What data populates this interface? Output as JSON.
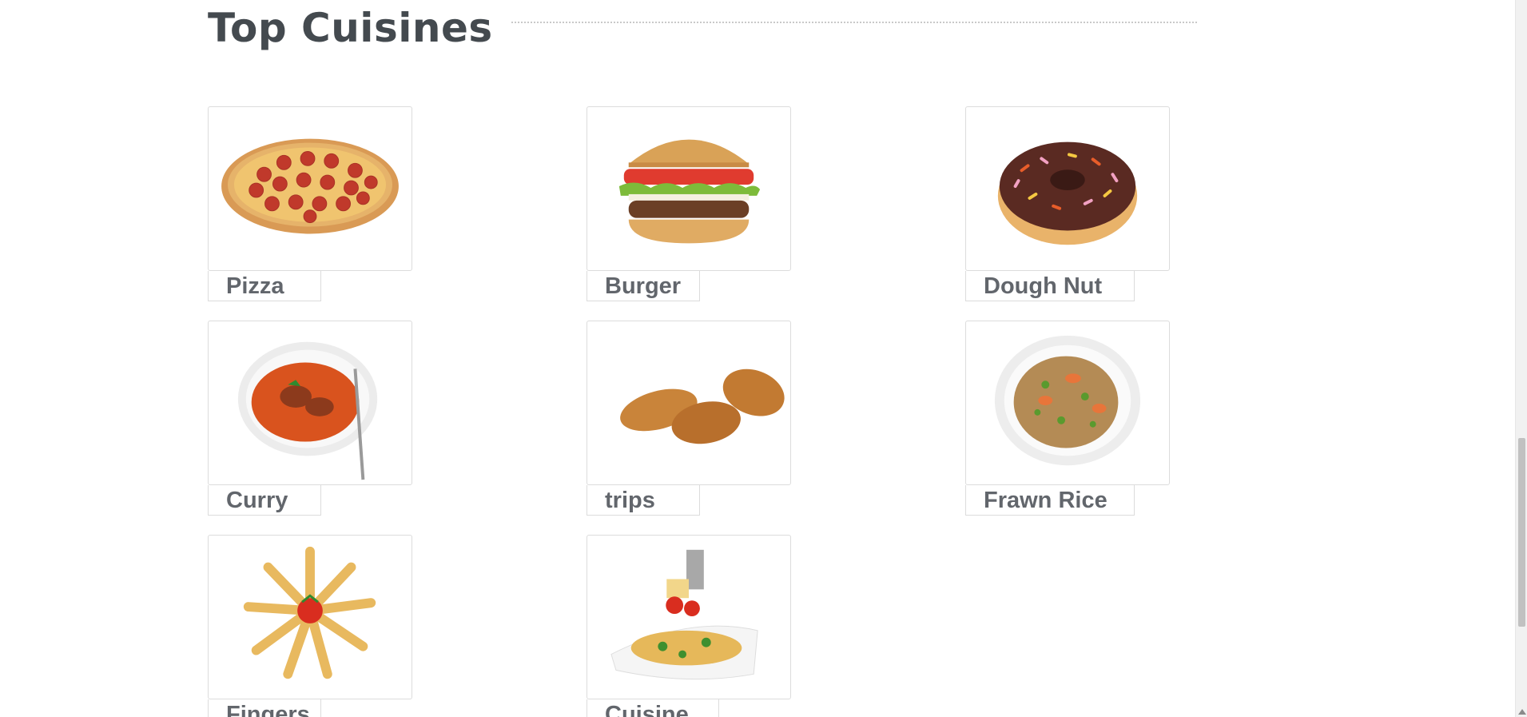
{
  "section": {
    "title": "Top Cuisines"
  },
  "cuisines": [
    {
      "label": "Pizza",
      "image": "pizza-image"
    },
    {
      "label": "Burger",
      "image": "burger-image"
    },
    {
      "label": "Dough Nut",
      "image": "doughnut-image"
    },
    {
      "label": "Curry",
      "image": "curry-image"
    },
    {
      "label": "trips",
      "image": "chicken-strips-image"
    },
    {
      "label": "Frawn Rice",
      "image": "prawn-rice-image"
    },
    {
      "label": "Fingers",
      "image": "pasta-fingers-image"
    },
    {
      "label": "Cuisine",
      "image": "pasta-salad-image"
    }
  ],
  "colors": {
    "title": "#444a4f",
    "label": "#62666c",
    "border": "#dcdcdc",
    "rule": "#c9c9c9"
  }
}
